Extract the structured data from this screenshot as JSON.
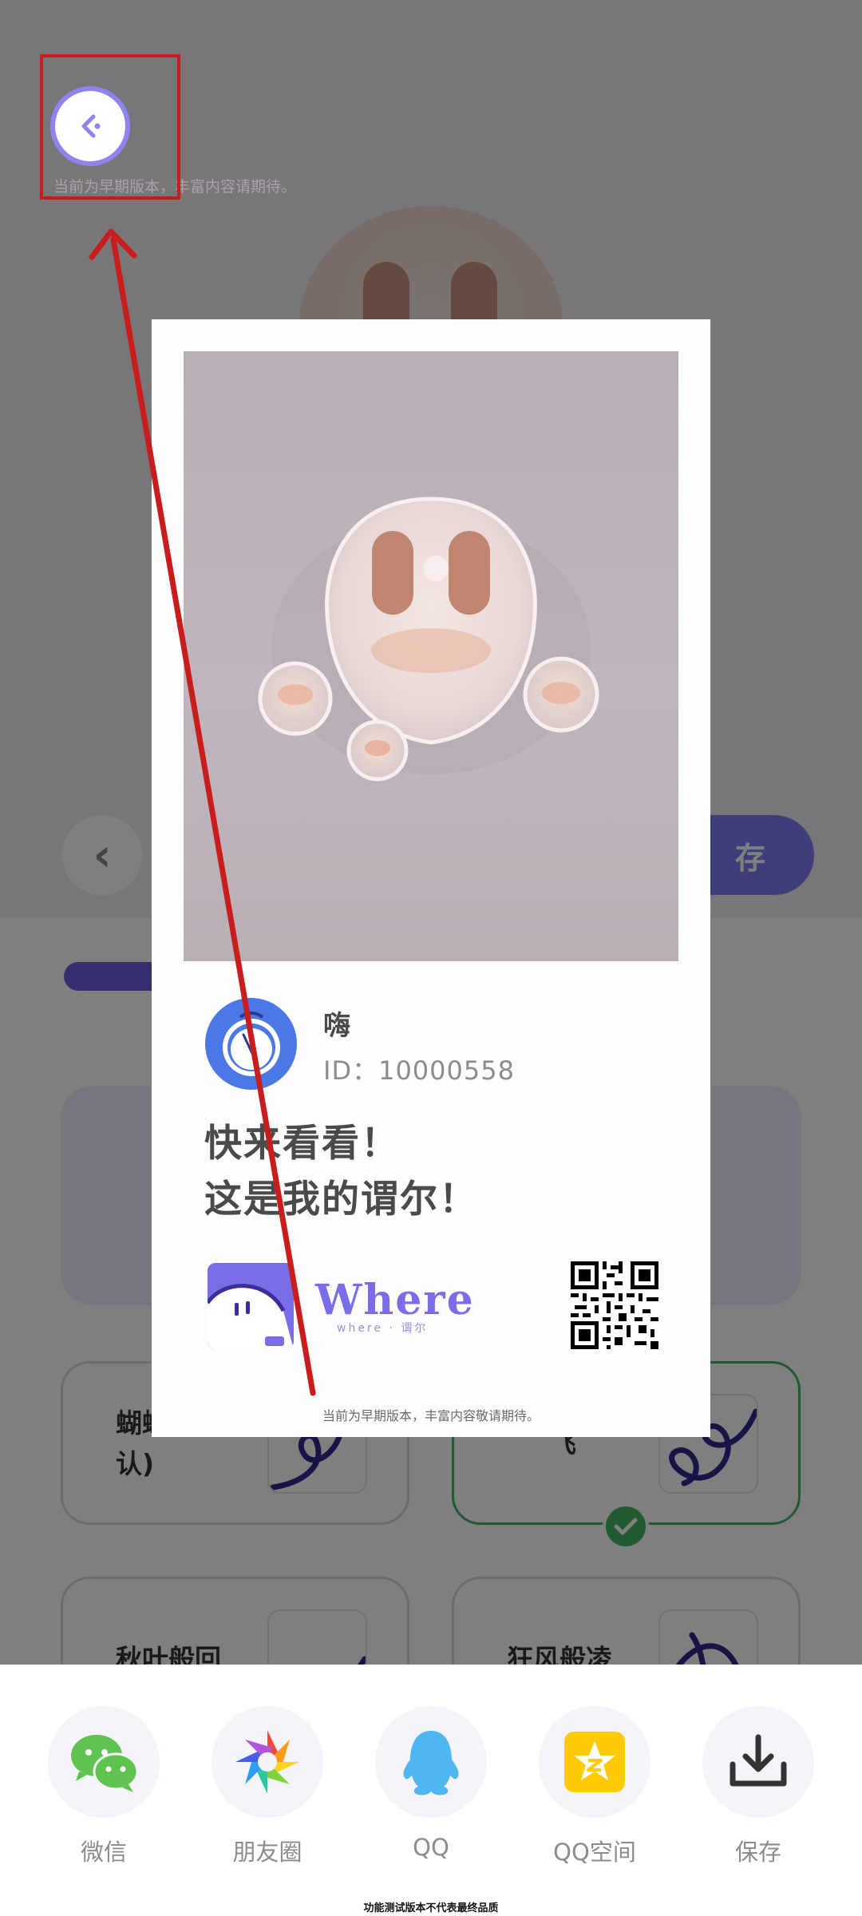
{
  "top": {
    "notice": "当前为早期版本，丰富内容请期待。"
  },
  "background": {
    "save_label": "存",
    "options": [
      {
        "label": "蝴蝶翅(默认)"
      },
      {
        "label": "飞",
        "selected": true
      },
      {
        "label": "秋叶般回"
      },
      {
        "label": "狂风般凌"
      }
    ]
  },
  "card": {
    "nickname": "嗨",
    "id_text": "ID：10000558",
    "message_line1": "快来看看！",
    "message_line2": "这是我的谓尔！",
    "brand_name": "Where",
    "brand_sub": "where · 谓尔",
    "notice": "当前为早期版本，丰富内容敬请期待。"
  },
  "share": {
    "items": [
      {
        "label": "微信",
        "icon": "wechat-icon"
      },
      {
        "label": "朋友圈",
        "icon": "moments-icon"
      },
      {
        "label": "QQ",
        "icon": "qq-icon"
      },
      {
        "label": "QQ空间",
        "icon": "qzone-icon"
      },
      {
        "label": "保存",
        "icon": "download-icon"
      }
    ]
  },
  "footer": {
    "note": "功能测试版本不代表最终品质"
  },
  "colors": {
    "accent": "#7a6ee8",
    "selected_green": "#42b562",
    "annotation_red": "#c91c1c"
  }
}
